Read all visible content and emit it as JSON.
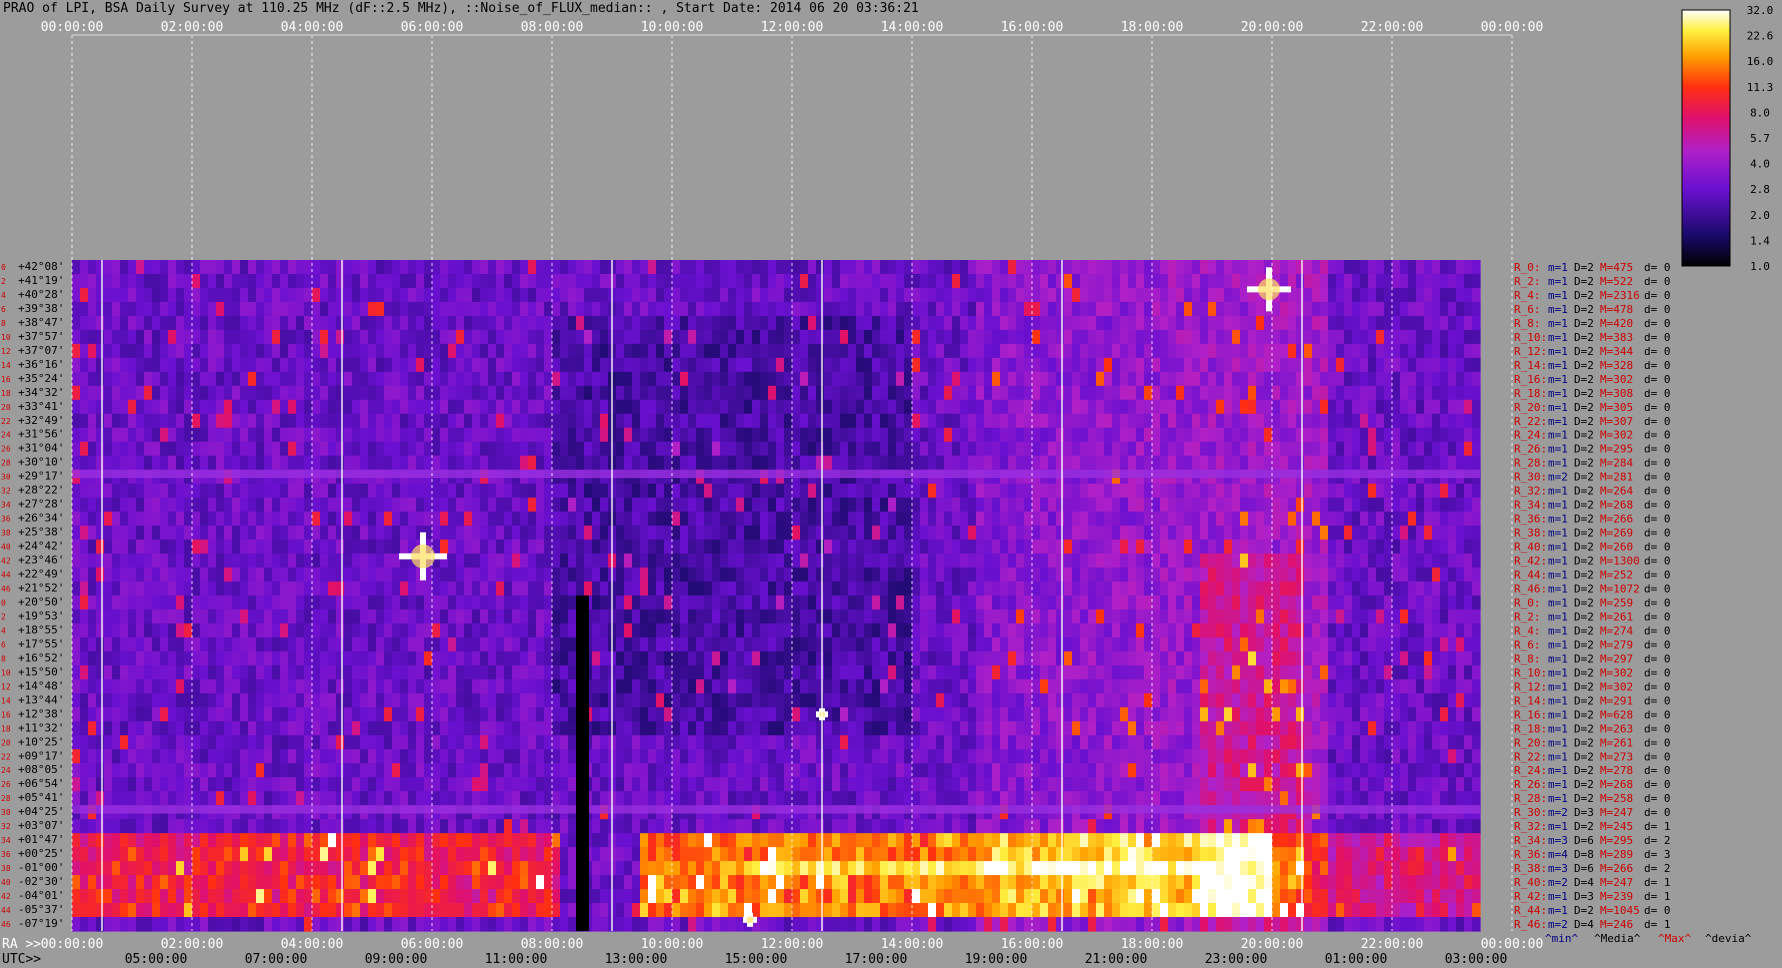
{
  "title": "PRAO of LPI, BSA Daily Survey at 110.25 MHz (dF::2.5 MHz), ::Noise_of_FLUX_median:: , Start Date: 2014 06 20 03:36:21",
  "chart_data": {
    "type": "heatmap",
    "x_top_ticks": [
      "00:00:00",
      "02:00:00",
      "04:00:00",
      "06:00:00",
      "08:00:00",
      "10:00:00",
      "12:00:00",
      "14:00:00",
      "16:00:00",
      "18:00:00",
      "20:00:00",
      "22:00:00",
      "00:00:00"
    ],
    "ra_label": "RA >>",
    "ra_ticks": [
      "00:00:00",
      "02:00:00",
      "04:00:00",
      "06:00:00",
      "08:00:00",
      "10:00:00",
      "12:00:00",
      "14:00:00",
      "16:00:00",
      "18:00:00",
      "20:00:00",
      "22:00:00",
      "00:00:00"
    ],
    "utc_label": "UTC>>",
    "utc_ticks": [
      "05:00:00",
      "07:00:00",
      "09:00:00",
      "11:00:00",
      "13:00:00",
      "15:00:00",
      "17:00:00",
      "19:00:00",
      "21:00:00",
      "23:00:00",
      "01:00:00",
      "03:00:00"
    ],
    "dec_labels": [
      "+42°08'",
      "+41°19'",
      "+40°28'",
      "+39°38'",
      "+38°47'",
      "+37°57'",
      "+37°07'",
      "+36°16'",
      "+35°24'",
      "+34°32'",
      "+33°41'",
      "+32°49'",
      "+31°56'",
      "+31°04'",
      "+30°10'",
      "+29°17'",
      "+28°22'",
      "+27°28'",
      "+26°34'",
      "+25°38'",
      "+24°42'",
      "+23°46'",
      "+22°49'",
      "+21°52'",
      "+20°50'",
      "+19°53'",
      "+18°55'",
      "+17°55'",
      "+16°52'",
      "+15°50'",
      "+14°48'",
      "+13°44'",
      "+12°38'",
      "+11°32'",
      "+10°25'",
      "+09°17'",
      "+08°05'",
      "+06°54'",
      "+05°41'",
      "+04°25'",
      "+03°07'",
      "+01°47'",
      "+00°25'",
      "-01°00'",
      "-02°30'",
      "-04°01'",
      "-05°37'",
      "-07°19'"
    ],
    "row_indices": [
      "0",
      "2",
      "4",
      "6",
      "8",
      "10",
      "12",
      "14",
      "16",
      "18",
      "20",
      "22",
      "24",
      "26",
      "28",
      "30",
      "32",
      "34",
      "36",
      "38",
      "40",
      "42",
      "44",
      "46",
      "0",
      "2",
      "4",
      "6",
      "8",
      "10",
      "12",
      "14",
      "16",
      "18",
      "20",
      "22",
      "24",
      "26",
      "28",
      "30",
      "32",
      "34",
      "36",
      "38",
      "40",
      "42",
      "44",
      "46"
    ],
    "beam_stats": [
      {
        "r": "R_0:",
        "min": "m=1",
        "med": "D=2",
        "max": "M=475",
        "dev": "d= 0"
      },
      {
        "r": "R_2:",
        "min": "m=1",
        "med": "D=2",
        "max": "M=522",
        "dev": "d= 0"
      },
      {
        "r": "R_4:",
        "min": "m=1",
        "med": "D=2",
        "max": "M=2316",
        "dev": "d= 0"
      },
      {
        "r": "R_6:",
        "min": "m=1",
        "med": "D=2",
        "max": "M=478",
        "dev": "d= 0"
      },
      {
        "r": "R_8:",
        "min": "m=1",
        "med": "D=2",
        "max": "M=420",
        "dev": "d= 0"
      },
      {
        "r": "R_10:",
        "min": "m=1",
        "med": "D=2",
        "max": "M=383",
        "dev": "d= 0"
      },
      {
        "r": "R_12:",
        "min": "m=1",
        "med": "D=2",
        "max": "M=344",
        "dev": "d= 0"
      },
      {
        "r": "R_14:",
        "min": "m=1",
        "med": "D=2",
        "max": "M=328",
        "dev": "d= 0"
      },
      {
        "r": "R_16:",
        "min": "m=1",
        "med": "D=2",
        "max": "M=302",
        "dev": "d= 0"
      },
      {
        "r": "R_18:",
        "min": "m=1",
        "med": "D=2",
        "max": "M=308",
        "dev": "d= 0"
      },
      {
        "r": "R_20:",
        "min": "m=1",
        "med": "D=2",
        "max": "M=305",
        "dev": "d= 0"
      },
      {
        "r": "R_22:",
        "min": "m=1",
        "med": "D=2",
        "max": "M=307",
        "dev": "d= 0"
      },
      {
        "r": "R_24:",
        "min": "m=1",
        "med": "D=2",
        "max": "M=302",
        "dev": "d= 0"
      },
      {
        "r": "R_26:",
        "min": "m=1",
        "med": "D=2",
        "max": "M=295",
        "dev": "d= 0"
      },
      {
        "r": "R_28:",
        "min": "m=1",
        "med": "D=2",
        "max": "M=284",
        "dev": "d= 0"
      },
      {
        "r": "R_30:",
        "min": "m=2",
        "med": "D=2",
        "max": "M=281",
        "dev": "d= 0"
      },
      {
        "r": "R_32:",
        "min": "m=1",
        "med": "D=2",
        "max": "M=264",
        "dev": "d= 0"
      },
      {
        "r": "R_34:",
        "min": "m=1",
        "med": "D=2",
        "max": "M=268",
        "dev": "d= 0"
      },
      {
        "r": "R_36:",
        "min": "m=1",
        "med": "D=2",
        "max": "M=266",
        "dev": "d= 0"
      },
      {
        "r": "R_38:",
        "min": "m=1",
        "med": "D=2",
        "max": "M=269",
        "dev": "d= 0"
      },
      {
        "r": "R_40:",
        "min": "m=1",
        "med": "D=2",
        "max": "M=260",
        "dev": "d= 0"
      },
      {
        "r": "R_42:",
        "min": "m=1",
        "med": "D=2",
        "max": "M=1300",
        "dev": "d= 0"
      },
      {
        "r": "R_44:",
        "min": "m=1",
        "med": "D=2",
        "max": "M=252",
        "dev": "d= 0"
      },
      {
        "r": "R_46:",
        "min": "m=1",
        "med": "D=2",
        "max": "M=1072",
        "dev": "d= 0"
      },
      {
        "r": "R_0:",
        "min": "m=1",
        "med": "D=2",
        "max": "M=259",
        "dev": "d= 0"
      },
      {
        "r": "R_2:",
        "min": "m=1",
        "med": "D=2",
        "max": "M=261",
        "dev": "d= 0"
      },
      {
        "r": "R_4:",
        "min": "m=1",
        "med": "D=2",
        "max": "M=274",
        "dev": "d= 0"
      },
      {
        "r": "R_6:",
        "min": "m=1",
        "med": "D=2",
        "max": "M=279",
        "dev": "d= 0"
      },
      {
        "r": "R_8:",
        "min": "m=1",
        "med": "D=2",
        "max": "M=297",
        "dev": "d= 0"
      },
      {
        "r": "R_10:",
        "min": "m=1",
        "med": "D=2",
        "max": "M=302",
        "dev": "d= 0"
      },
      {
        "r": "R_12:",
        "min": "m=1",
        "med": "D=2",
        "max": "M=302",
        "dev": "d= 0"
      },
      {
        "r": "R_14:",
        "min": "m=1",
        "med": "D=2",
        "max": "M=291",
        "dev": "d= 0"
      },
      {
        "r": "R_16:",
        "min": "m=1",
        "med": "D=2",
        "max": "M=628",
        "dev": "d= 0"
      },
      {
        "r": "R_18:",
        "min": "m=1",
        "med": "D=2",
        "max": "M=263",
        "dev": "d= 0"
      },
      {
        "r": "R_20:",
        "min": "m=1",
        "med": "D=2",
        "max": "M=261",
        "dev": "d= 0"
      },
      {
        "r": "R_22:",
        "min": "m=1",
        "med": "D=2",
        "max": "M=273",
        "dev": "d= 0"
      },
      {
        "r": "R_24:",
        "min": "m=1",
        "med": "D=2",
        "max": "M=278",
        "dev": "d= 0"
      },
      {
        "r": "R_26:",
        "min": "m=1",
        "med": "D=2",
        "max": "M=268",
        "dev": "d= 0"
      },
      {
        "r": "R_28:",
        "min": "m=1",
        "med": "D=2",
        "max": "M=258",
        "dev": "d= 0"
      },
      {
        "r": "R_30:",
        "min": "m=2",
        "med": "D=3",
        "max": "M=247",
        "dev": "d= 0"
      },
      {
        "r": "R_32:",
        "min": "m=1",
        "med": "D=2",
        "max": "M=245",
        "dev": "d= 1"
      },
      {
        "r": "R_34:",
        "min": "m=3",
        "med": "D=6",
        "max": "M=295",
        "dev": "d= 2"
      },
      {
        "r": "R_36:",
        "min": "m=4",
        "med": "D=8",
        "max": "M=289",
        "dev": "d= 3"
      },
      {
        "r": "R_38:",
        "min": "m=3",
        "med": "D=6",
        "max": "M=266",
        "dev": "d= 2"
      },
      {
        "r": "R_40:",
        "min": "m=2",
        "med": "D=4",
        "max": "M=247",
        "dev": "d= 1"
      },
      {
        "r": "R_42:",
        "min": "m=1",
        "med": "D=3",
        "max": "M=239",
        "dev": "d= 1"
      },
      {
        "r": "R_44:",
        "min": "m=1",
        "med": "D=2",
        "max": "M=1045",
        "dev": "d= 0"
      },
      {
        "r": "R_46:",
        "min": "m=2",
        "med": "D=4",
        "max": "M=246",
        "dev": "d= 1"
      }
    ],
    "stats_legend": {
      "min": "^min^",
      "med": "^Media^",
      "max": "^Max^",
      "dev": "^devia^"
    },
    "colorbar_ticks": [
      "32.0",
      "22.6",
      "16.0",
      "11.3",
      "8.0",
      "5.7",
      "4.0",
      "2.8",
      "2.0",
      "1.4",
      "1.0"
    ],
    "colors": {
      "background": "#9c9c9c",
      "row_label": "#cc0000",
      "dec_label": "#000000",
      "min_color": "#000080",
      "med_color": "#000000",
      "max_color": "#cc0000",
      "grid": "#ffffff"
    }
  }
}
